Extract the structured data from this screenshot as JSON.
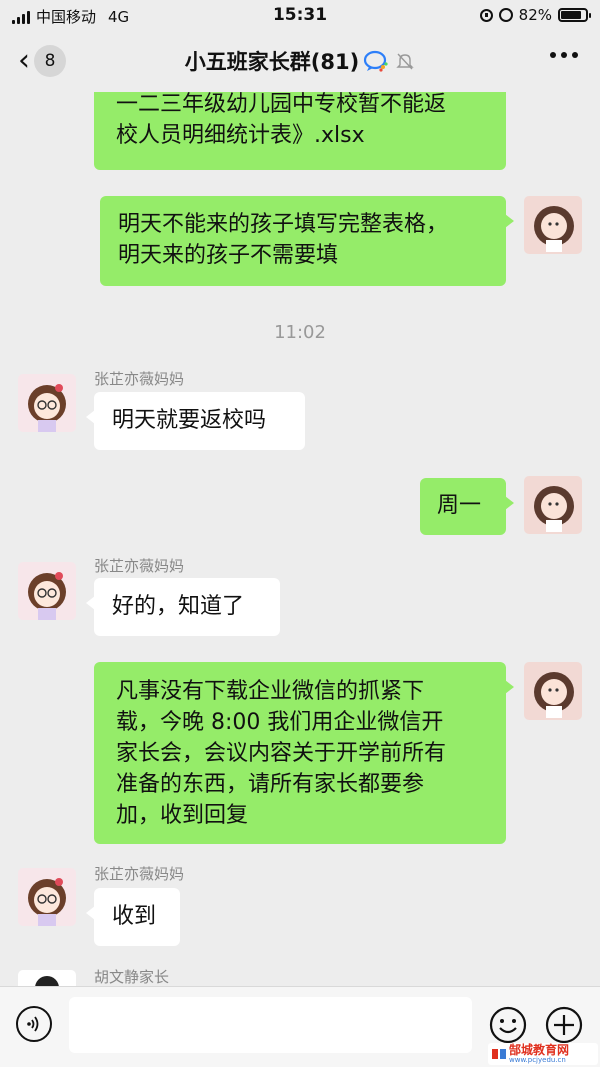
{
  "status_bar": {
    "carrier": "中国移动",
    "network": "4G",
    "time": "15:31",
    "battery": "82%",
    "battery_level": 0.82
  },
  "nav": {
    "unread_count": "8",
    "title": "小五班家长群(81)"
  },
  "messages": [
    {
      "side": "right",
      "text_lines": [
        "一二三年级幼儿园中专校暂不能返",
        "校人员明细统计表》.xlsx"
      ]
    },
    {
      "side": "right",
      "text_lines": [
        "明天不能来的孩子填写完整表格，",
        "明天来的孩子不需要填"
      ]
    },
    {
      "side": "timestamp",
      "text": "11:02"
    },
    {
      "side": "left",
      "sender": "张芷亦薇妈妈",
      "text": "明天就要返校吗"
    },
    {
      "side": "right",
      "text": "周一"
    },
    {
      "side": "left",
      "sender": "张芷亦薇妈妈",
      "text": "好的，知道了"
    },
    {
      "side": "right",
      "text_lines": [
        "凡事没有下载企业微信的抓紧下",
        "载，今晚 8:00 我们用企业微信开",
        "家长会，会议内容关于开学前所有",
        "准备的东西，请所有家长都要参",
        "加，收到回复"
      ]
    },
    {
      "side": "left",
      "sender": "张芷亦薇妈妈",
      "text": "收到"
    },
    {
      "side": "left",
      "sender": "胡文静家长",
      "text": ""
    }
  ],
  "input": {
    "placeholder": ""
  },
  "watermark": {
    "text": "郜城教育网",
    "sub": "www.pcjyedu.cn"
  },
  "colors": {
    "bubble_self": "#95ec69",
    "bubble_other": "#ffffff",
    "background": "#ededed"
  },
  "icons": [
    "back-chevron-icon",
    "wecom-icon",
    "mute-bell-icon",
    "more-icon",
    "voice-icon",
    "emoji-icon",
    "plus-icon"
  ]
}
